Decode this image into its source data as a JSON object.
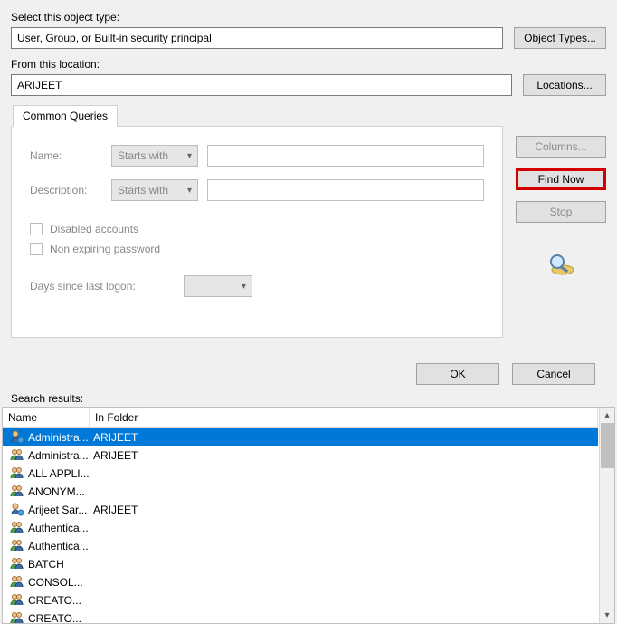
{
  "labels": {
    "select_object_type": "Select this object type:",
    "from_location": "From this location:",
    "object_types_btn": "Object Types...",
    "locations_btn": "Locations...",
    "tab_common_queries": "Common Queries",
    "name": "Name:",
    "description": "Description:",
    "starts_with": "Starts with",
    "disabled_accounts": "Disabled accounts",
    "non_expiring_password": "Non expiring password",
    "days_since_last_logon": "Days since last logon:",
    "columns_btn": "Columns...",
    "find_now_btn": "Find Now",
    "stop_btn": "Stop",
    "ok_btn": "OK",
    "cancel_btn": "Cancel",
    "search_results": "Search results:",
    "col_name": "Name",
    "col_in_folder": "In Folder"
  },
  "fields": {
    "object_type": "User, Group, or Built-in security principal",
    "location": "ARIJEET"
  },
  "results": [
    {
      "name": "Administra...",
      "folder": "ARIJEET",
      "icon": "user",
      "selected": true
    },
    {
      "name": "Administra...",
      "folder": "ARIJEET",
      "icon": "group",
      "selected": false
    },
    {
      "name": "ALL APPLI...",
      "folder": "",
      "icon": "group",
      "selected": false
    },
    {
      "name": "ANONYM...",
      "folder": "",
      "icon": "group",
      "selected": false
    },
    {
      "name": "Arijeet Sar...",
      "folder": "ARIJEET",
      "icon": "user",
      "selected": false
    },
    {
      "name": "Authentica...",
      "folder": "",
      "icon": "group",
      "selected": false
    },
    {
      "name": "Authentica...",
      "folder": "",
      "icon": "group",
      "selected": false
    },
    {
      "name": "BATCH",
      "folder": "",
      "icon": "group",
      "selected": false
    },
    {
      "name": "CONSOL...",
      "folder": "",
      "icon": "group",
      "selected": false
    },
    {
      "name": "CREATO...",
      "folder": "",
      "icon": "group",
      "selected": false
    },
    {
      "name": "CREATO...",
      "folder": "",
      "icon": "group",
      "selected": false
    }
  ]
}
